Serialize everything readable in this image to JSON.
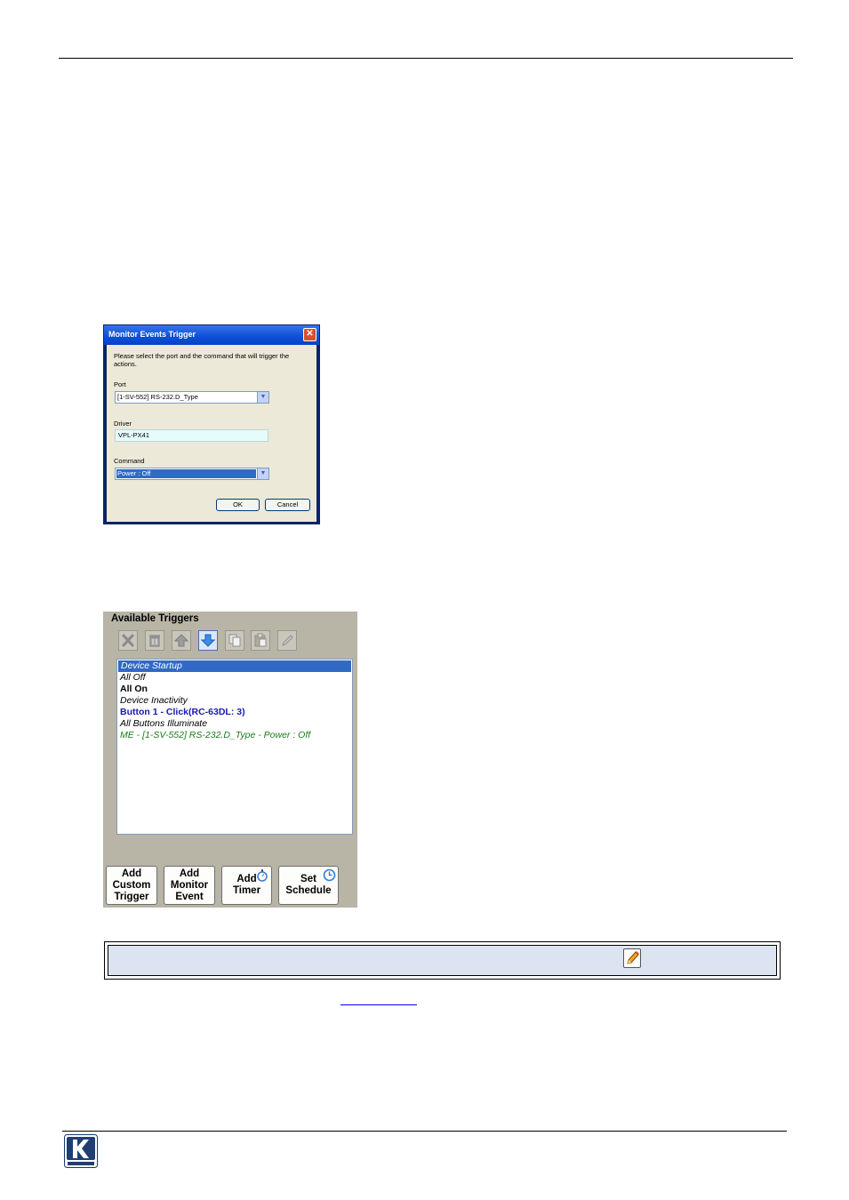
{
  "dialog": {
    "title": "Monitor Events Trigger",
    "close_label": "✕",
    "instructions": "Please select the port and the command that will trigger the actions.",
    "port_label": "Port",
    "port_value": "[1-SV-552] RS-232.D_Type",
    "driver_label": "Driver",
    "driver_value": "VPL-PX41",
    "command_label": "Command",
    "command_value": "Power : Off",
    "ok_label": "OK",
    "cancel_label": "Cancel",
    "colors": {
      "title_bar": "#0b4fd8",
      "selection": "#3169c6",
      "driver_field": "#e6fbfb"
    }
  },
  "triggers_panel": {
    "title": "Available Triggers",
    "toolbar_icons": [
      "delete-icon",
      "trash-icon",
      "move-up-icon",
      "move-down-icon",
      "copy-icon",
      "paste-icon",
      "edit-icon"
    ],
    "items": [
      {
        "label": "Device Startup",
        "style": "italic",
        "color": "#ffffff",
        "selected": true
      },
      {
        "label": "All Off",
        "style": "italic",
        "color": "#000000"
      },
      {
        "label": "All On",
        "style": "bold",
        "color": "#000000"
      },
      {
        "label": "Device Inactivity",
        "style": "italic",
        "color": "#000000"
      },
      {
        "label": "Button 1 - Click(RC-63DL: 3)",
        "style": "bold",
        "color": "#1a1aa6"
      },
      {
        "label": "All Buttons Illuminate",
        "style": "italic",
        "color": "#000000"
      },
      {
        "label": "ME - [1-SV-552] RS-232.D_Type - Power : Off",
        "style": "italic",
        "color": "#1b7a1b"
      }
    ],
    "buttons": [
      {
        "lines": [
          "Add",
          "Custom",
          "Trigger"
        ]
      },
      {
        "lines": [
          "Add",
          "Monitor",
          "Event"
        ]
      },
      {
        "lines": [
          "Add",
          "Timer"
        ],
        "icon": "stopwatch-icon"
      },
      {
        "lines": [
          "Set",
          "Schedule"
        ],
        "icon": "clock-icon"
      }
    ]
  },
  "note": {
    "icon": "pencil-icon",
    "background": "#dce4f1"
  },
  "footer": {
    "logo_text": "KRAMER"
  }
}
